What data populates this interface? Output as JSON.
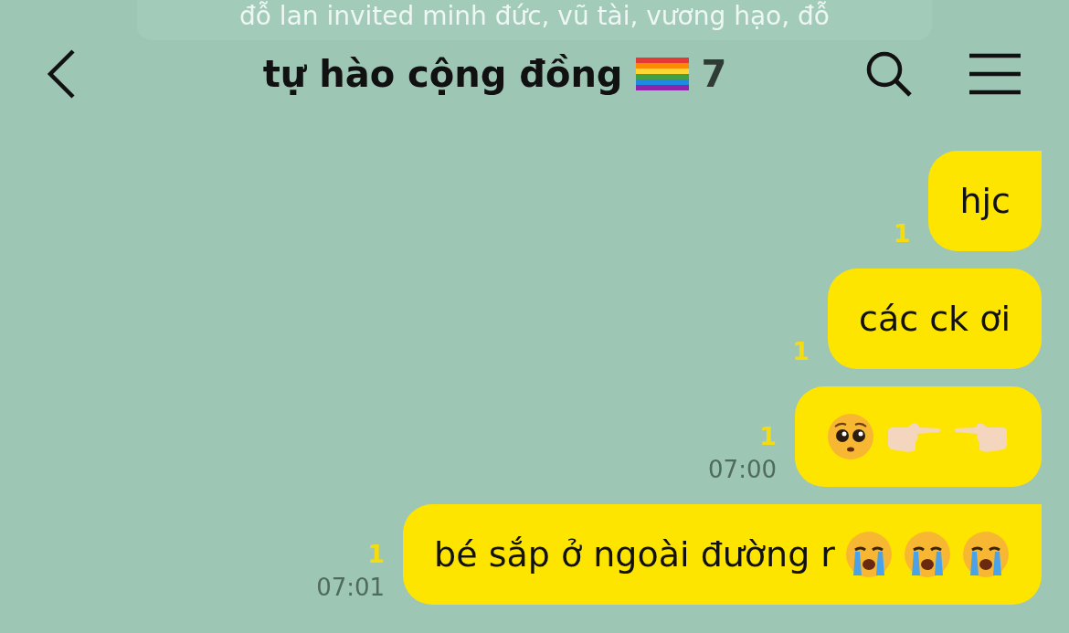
{
  "banner": {
    "text": "đỗ lan invited minh đức, vũ tài, vương hạo, đỗ"
  },
  "header": {
    "title": "tự hào cộng đồng",
    "count": "7"
  },
  "messages": [
    {
      "text": "hjc",
      "unread": "1",
      "tail": true
    },
    {
      "text": "các ck ơi",
      "unread": "1",
      "tail": false
    },
    {
      "emoji": [
        {
          "kind": "pleading"
        },
        {
          "kind": "point-right"
        },
        {
          "kind": "point-left"
        }
      ],
      "unread": "1",
      "time": "07:00",
      "tail": false
    },
    {
      "text": "bé sắp ở ngoài đường r",
      "emoji": [
        {
          "kind": "crying"
        },
        {
          "kind": "crying"
        },
        {
          "kind": "crying"
        }
      ],
      "unread": "1",
      "time": "07:01",
      "tail": true
    }
  ]
}
